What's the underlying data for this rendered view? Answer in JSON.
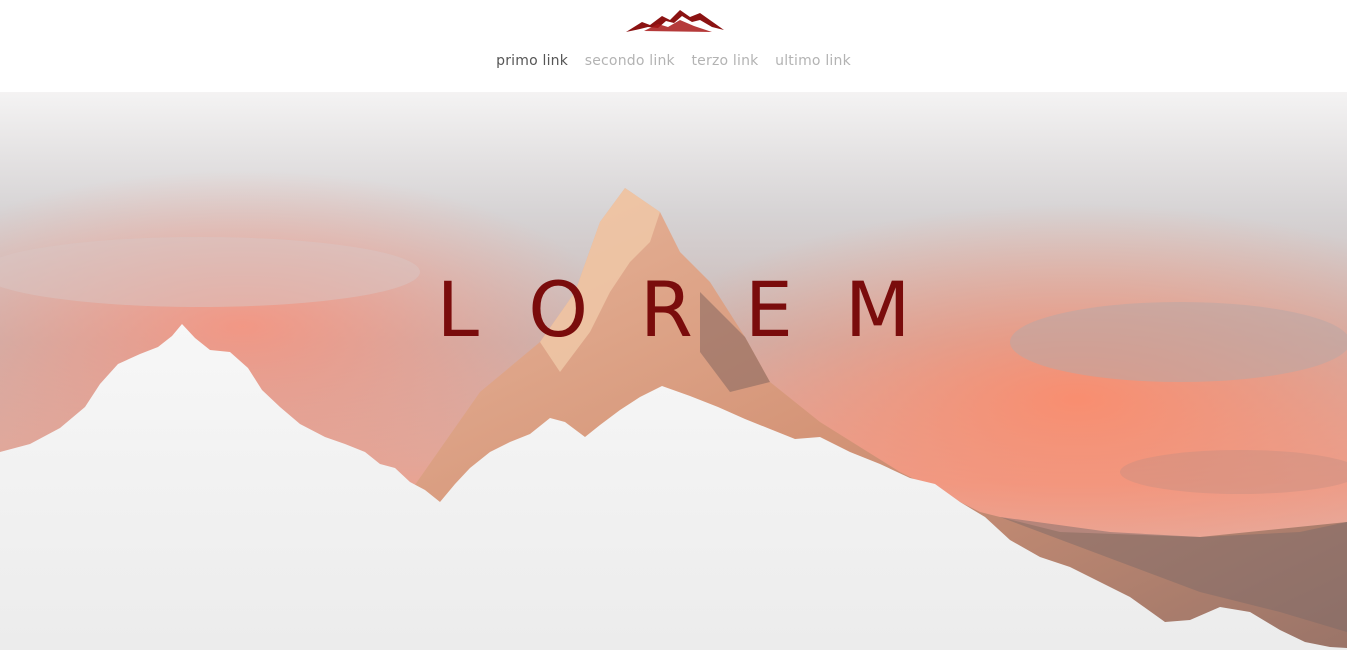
{
  "brand": {
    "logo_icon": "mountain-logo-icon",
    "logo_color": "#8b1212"
  },
  "nav": {
    "items": [
      {
        "label": "primo link",
        "active": true
      },
      {
        "label": "secondo link",
        "active": false
      },
      {
        "label": "terzo link",
        "active": false
      },
      {
        "label": "ultimo link",
        "active": false
      }
    ]
  },
  "hero": {
    "title": "LOREM",
    "title_color": "#7a0c0c",
    "image": "mountain-peak-at-sunset",
    "foreground": "white-mountain-silhouette"
  }
}
